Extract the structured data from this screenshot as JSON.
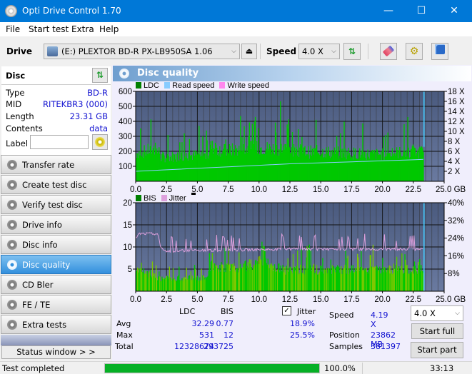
{
  "window": {
    "title": "Opti Drive Control 1.70",
    "minimize": "—",
    "maximize": "☐",
    "close": "✕"
  },
  "menu": [
    "File",
    "Start test",
    "Extra",
    "Help"
  ],
  "toolbar": {
    "drive_label": "Drive",
    "drive_value": "(E:)  PLEXTOR BD-R  PX-LB950SA 1.06",
    "speed_label": "Speed",
    "speed_value": "4.0 X"
  },
  "disc": {
    "header": "Disc",
    "type_label": "Type",
    "type_value": "BD-R",
    "mid_label": "MID",
    "mid_value": "RITEKBR3 (000)",
    "length_label": "Length",
    "length_value": "23.31 GB",
    "contents_label": "Contents",
    "contents_value": "data",
    "label_label": "Label",
    "label_value": ""
  },
  "nav": [
    {
      "label": "Transfer rate",
      "active": false
    },
    {
      "label": "Create test disc",
      "active": false
    },
    {
      "label": "Verify test disc",
      "active": false
    },
    {
      "label": "Drive info",
      "active": false
    },
    {
      "label": "Disc info",
      "active": false
    },
    {
      "label": "Disc quality",
      "active": true
    },
    {
      "label": "CD Bler",
      "active": false
    },
    {
      "label": "FE / TE",
      "active": false
    },
    {
      "label": "Extra tests",
      "active": false
    }
  ],
  "status_window_label": "Status window > >",
  "panel": {
    "title": "Disc quality"
  },
  "colors": {
    "ldc": "#00c800",
    "bis": "#00c800",
    "read_speed": "#88ccff",
    "write_speed": "#ff88ee",
    "jitter": "#dda0dd",
    "plot_bg_top": "#4a5a7e",
    "plot_bg_bottom": "#6a7aa0",
    "accent": "#0078d7"
  },
  "chart_data": [
    {
      "type": "bar",
      "title": "LDC / Read speed",
      "legend": [
        "LDC",
        "Read speed",
        "Write speed"
      ],
      "legend_placement": "top-left",
      "xlabel": "GB",
      "x_ticks": [
        "0.0",
        "2.5",
        "5.0",
        "7.5",
        "10.0",
        "12.5",
        "15.0",
        "17.5",
        "20.0",
        "22.5",
        "25.0 GB"
      ],
      "xlim": [
        0,
        25
      ],
      "ylim_left": [
        0,
        600
      ],
      "y_ticks_left": [
        "100",
        "200",
        "300",
        "400",
        "500",
        "600"
      ],
      "ylim_right": [
        0,
        18
      ],
      "y_ticks_right": [
        "2 X",
        "4 X",
        "6 X",
        "8 X",
        "10 X",
        "12 X",
        "14 X",
        "16 X",
        "18 X"
      ],
      "grid": true,
      "series": [
        {
          "name": "LDC",
          "profile": [
            [
              0,
              195
            ],
            [
              0.5,
              200
            ],
            [
              1.0,
              210
            ],
            [
              1.5,
              220
            ],
            [
              1.9,
              200
            ],
            [
              2.0,
              165
            ],
            [
              3.0,
              170
            ],
            [
              4.0,
              175
            ],
            [
              5.0,
              180
            ],
            [
              5.8,
              175
            ],
            [
              6.0,
              240
            ],
            [
              7.0,
              210
            ],
            [
              8.0,
              215
            ],
            [
              9.0,
              225
            ],
            [
              10.0,
              230
            ],
            [
              11.0,
              225
            ],
            [
              12.0,
              225
            ],
            [
              13.0,
              215
            ],
            [
              14.0,
              200
            ],
            [
              15.0,
              205
            ],
            [
              16.0,
              195
            ],
            [
              17.0,
              195
            ],
            [
              18.0,
              190
            ],
            [
              19.0,
              185
            ],
            [
              20.0,
              185
            ],
            [
              21.0,
              195
            ],
            [
              22.0,
              200
            ],
            [
              23.3,
              200
            ]
          ],
          "end_gb": 23.31,
          "peak": 531
        },
        {
          "name": "Read speed",
          "points": [
            [
              0,
              2.0
            ],
            [
              2.5,
              2.3
            ],
            [
              5.0,
              2.6
            ],
            [
              7.5,
              2.9
            ],
            [
              10.0,
              3.2
            ],
            [
              12.5,
              3.5
            ],
            [
              15.0,
              3.7
            ],
            [
              17.5,
              3.9
            ],
            [
              20.0,
              4.1
            ],
            [
              22.5,
              4.3
            ],
            [
              23.31,
              4.4
            ]
          ]
        }
      ]
    },
    {
      "type": "bar",
      "title": "BIS / Jitter",
      "legend": [
        "BIS",
        "Jitter"
      ],
      "legend_placement": "top-left",
      "xlabel": "GB",
      "x_ticks": [
        "0.0",
        "2.5",
        "5.0",
        "7.5",
        "10.0",
        "12.5",
        "15.0",
        "17.5",
        "20.0",
        "22.5",
        "25.0 GB"
      ],
      "xlim": [
        0,
        25
      ],
      "ylim_left": [
        0,
        20
      ],
      "y_ticks_left": [
        "5",
        "10",
        "15",
        "20"
      ],
      "ylim_right": [
        0,
        40
      ],
      "y_ticks_right": [
        "8%",
        "16%",
        "24%",
        "32%",
        "40%"
      ],
      "grid": true,
      "series": [
        {
          "name": "BIS",
          "profile": [
            [
              0,
              5
            ],
            [
              2.0,
              3
            ],
            [
              5.8,
              3
            ],
            [
              6.0,
              6
            ],
            [
              8.0,
              5
            ],
            [
              10.0,
              7
            ],
            [
              12.0,
              5
            ],
            [
              23.3,
              5
            ]
          ],
          "end_gb": 23.31,
          "max": 12
        },
        {
          "name": "Jitter",
          "points_pct": [
            [
              0,
              24
            ],
            [
              0.3,
              26
            ],
            [
              1.8,
              26
            ],
            [
              2.0,
              20
            ],
            [
              2.5,
              18
            ],
            [
              5.0,
              18.5
            ],
            [
              7.5,
              18.5
            ],
            [
              10.0,
              18.8
            ],
            [
              12.5,
              19
            ],
            [
              15.0,
              19
            ],
            [
              17.5,
              19
            ],
            [
              20.0,
              19
            ],
            [
              22.5,
              19
            ],
            [
              23.31,
              19
            ]
          ]
        }
      ]
    }
  ],
  "stats": {
    "col_ldc": "LDC",
    "col_bis": "BIS",
    "jitter_label": "Jitter",
    "jitter_checked": true,
    "avg_label": "Avg",
    "avg_ldc": "32.29",
    "avg_bis": "0.77",
    "avg_jitter": "18.9%",
    "max_label": "Max",
    "max_ldc": "531",
    "max_bis": "12",
    "max_jitter": "25.5%",
    "total_label": "Total",
    "total_ldc": "12328674",
    "total_bis": "293725",
    "speed_label": "Speed",
    "speed_value": "4.19 X",
    "position_label": "Position",
    "position_value": "23862 MB",
    "samples_label": "Samples",
    "samples_value": "381397",
    "speed_select": "4.0 X",
    "start_full": "Start full",
    "start_part": "Start part"
  },
  "status": {
    "text": "Test completed",
    "progress": 100.0,
    "progress_text": "100.0%",
    "time": "33:13"
  }
}
